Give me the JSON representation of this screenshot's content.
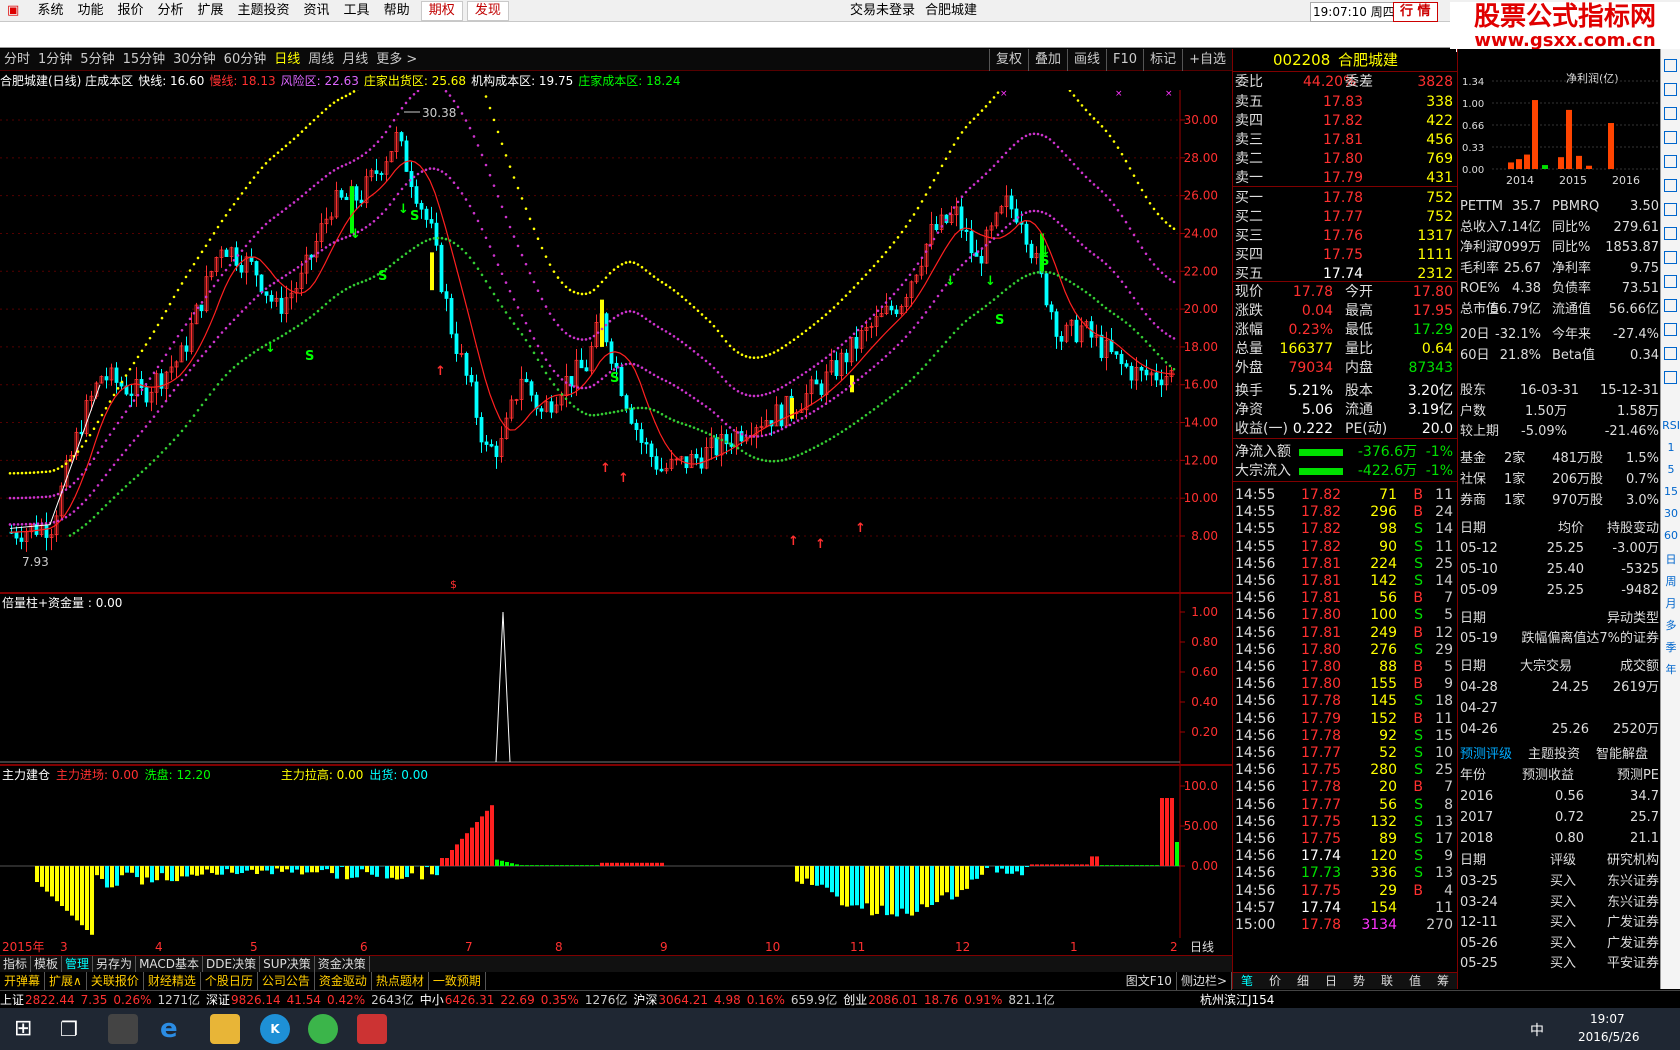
{
  "menu": [
    "系统",
    "功能",
    "报价",
    "分析",
    "扩展",
    "主题投资",
    "资讯",
    "工具",
    "帮助"
  ],
  "menu_hl": [
    "期权",
    "发现"
  ],
  "login": "交易未登录",
  "stock_name_top": "合肥城建",
  "clock": "19:07:10 周四",
  "trade_btn": "行 情",
  "brand": {
    "title": "股票公式指标网",
    "url": "www.gsxx.com.cn"
  },
  "timeframes": [
    "分时",
    "1分钟",
    "5分钟",
    "15分钟",
    "30分钟",
    "60分钟",
    "日线",
    "周线",
    "月线",
    "更多 >"
  ],
  "active_tf": "日线",
  "tf_right": [
    "复权",
    "叠加",
    "画线",
    "F10",
    "标记",
    "+自选"
  ],
  "ind1": [
    {
      "t": "合肥城建(日线) 庄成本区",
      "c": "#ffffff"
    },
    {
      "t": "快线: 16.60",
      "c": "#ffffff"
    },
    {
      "t": "慢线: 18.13",
      "c": "#ff3030"
    },
    {
      "t": "风险区: 22.63",
      "c": "#dd66ff"
    },
    {
      "t": "庄家出货区: 25.68",
      "c": "#ffff00"
    },
    {
      "t": "机构成本区: 19.75",
      "c": "#ffffff"
    },
    {
      "t": "庄家成本区: 18.24",
      "c": "#00ff00"
    }
  ],
  "price_axis": [
    "30.00",
    "28.00",
    "26.00",
    "24.00",
    "22.00",
    "20.00",
    "18.00",
    "16.00",
    "14.00",
    "12.00",
    "10.00",
    "8.00"
  ],
  "peak_label": "30.38",
  "low_label": "7.93",
  "ind2_title": "倍量柱+资金量 : 0.00",
  "ind2_axis": [
    "1.00",
    "0.80",
    "0.60",
    "0.40",
    "0.20"
  ],
  "ind3": [
    {
      "t": "主力建仓",
      "c": "#ffffff"
    },
    {
      "t": "主力进场: 0.00",
      "c": "#ff3030"
    },
    {
      "t": "洗盘: 12.20",
      "c": "#00ff00"
    },
    {
      "t": "主力拉高: 0.00",
      "c": "#ffff00"
    },
    {
      "t": "出货: 0.00",
      "c": "#00ffff"
    }
  ],
  "ind3_axis": [
    "100.0",
    "50.00",
    "0.00"
  ],
  "date_axis": [
    "2015年",
    "3",
    "4",
    "5",
    "6",
    "7",
    "8",
    "9",
    "10",
    "11",
    "12",
    "1",
    "2"
  ],
  "period_label": "日线",
  "quote": {
    "code": "002208",
    "name": "合肥城建",
    "weibi_l": "委比",
    "weibi": "44.20%",
    "weicha_l": "委差",
    "weicha": "3828",
    "asks": [
      {
        "l": "卖五",
        "p": "17.83",
        "v": "338"
      },
      {
        "l": "卖四",
        "p": "17.82",
        "v": "422"
      },
      {
        "l": "卖三",
        "p": "17.81",
        "v": "456"
      },
      {
        "l": "卖二",
        "p": "17.80",
        "v": "769"
      },
      {
        "l": "卖一",
        "p": "17.79",
        "v": "431"
      }
    ],
    "bids": [
      {
        "l": "买一",
        "p": "17.78",
        "v": "752"
      },
      {
        "l": "买二",
        "p": "17.77",
        "v": "752"
      },
      {
        "l": "买三",
        "p": "17.76",
        "v": "1317"
      },
      {
        "l": "买四",
        "p": "17.75",
        "v": "1111"
      },
      {
        "l": "买五",
        "p": "17.74",
        "v": "2312"
      }
    ],
    "stats": [
      {
        "l1": "现价",
        "v1": "17.78",
        "c1": "#ff3030",
        "l2": "今开",
        "v2": "17.80",
        "c2": "#ff3030"
      },
      {
        "l1": "涨跌",
        "v1": "0.04",
        "c1": "#ff3030",
        "l2": "最高",
        "v2": "17.95",
        "c2": "#ff3030"
      },
      {
        "l1": "涨幅",
        "v1": "0.23%",
        "c1": "#ff3030",
        "l2": "最低",
        "v2": "17.29",
        "c2": "#00e000"
      },
      {
        "l1": "总量",
        "v1": "166377",
        "c1": "#ffff00",
        "l2": "量比",
        "v2": "0.64",
        "c2": "#ffff00"
      },
      {
        "l1": "外盘",
        "v1": "79034",
        "c1": "#ff3030",
        "l2": "内盘",
        "v2": "87343",
        "c2": "#00e000"
      },
      {
        "l1": "换手",
        "v1": "5.21%",
        "c1": "#ffffff",
        "l2": "股本",
        "v2": "3.20亿",
        "c2": "#ffffff"
      },
      {
        "l1": "净资",
        "v1": "5.06",
        "c1": "#ffffff",
        "l2": "流通",
        "v2": "3.19亿",
        "c2": "#ffffff"
      },
      {
        "l1": "收益(一)",
        "v1": "0.222",
        "c1": "#ffffff",
        "l2": "PE(动)",
        "v2": "20.0",
        "c2": "#ffffff"
      }
    ],
    "flow": [
      {
        "l": "净流入额",
        "v": "-376.6万",
        "p": "-1%"
      },
      {
        "l": "大宗流入",
        "v": "-422.6万",
        "p": "-1%"
      }
    ],
    "ticks": [
      [
        "14:55",
        "17.82",
        "71",
        "B",
        "11"
      ],
      [
        "14:55",
        "17.82",
        "296",
        "B",
        "24"
      ],
      [
        "14:55",
        "17.82",
        "98",
        "S",
        "14"
      ],
      [
        "14:55",
        "17.82",
        "90",
        "S",
        "11"
      ],
      [
        "14:56",
        "17.81",
        "224",
        "S",
        "25"
      ],
      [
        "14:56",
        "17.81",
        "142",
        "S",
        "14"
      ],
      [
        "14:56",
        "17.81",
        "56",
        "B",
        "7"
      ],
      [
        "14:56",
        "17.80",
        "100",
        "S",
        "5"
      ],
      [
        "14:56",
        "17.81",
        "249",
        "B",
        "12"
      ],
      [
        "14:56",
        "17.80",
        "276",
        "S",
        "29"
      ],
      [
        "14:56",
        "17.80",
        "88",
        "B",
        "5"
      ],
      [
        "14:56",
        "17.80",
        "155",
        "B",
        "9"
      ],
      [
        "14:56",
        "17.78",
        "145",
        "S",
        "18"
      ],
      [
        "14:56",
        "17.79",
        "152",
        "B",
        "11"
      ],
      [
        "14:56",
        "17.78",
        "92",
        "S",
        "15"
      ],
      [
        "14:56",
        "17.77",
        "52",
        "S",
        "10"
      ],
      [
        "14:56",
        "17.75",
        "280",
        "S",
        "25"
      ],
      [
        "14:56",
        "17.78",
        "20",
        "B",
        "7"
      ],
      [
        "14:56",
        "17.77",
        "56",
        "S",
        "8"
      ],
      [
        "14:56",
        "17.75",
        "132",
        "S",
        "13"
      ],
      [
        "14:56",
        "17.75",
        "89",
        "S",
        "17"
      ],
      [
        "14:56",
        "17.74",
        "120",
        "S",
        "9"
      ],
      [
        "14:56",
        "17.73",
        "336",
        "S",
        "13"
      ],
      [
        "14:56",
        "17.75",
        "29",
        "B",
        "4"
      ],
      [
        "14:57",
        "17.74",
        "154",
        "",
        "11"
      ],
      [
        "15:00",
        "17.78",
        "3134",
        "",
        "270"
      ]
    ],
    "bottom_tabs": [
      "笔",
      "价",
      "细",
      "日",
      "势",
      "联",
      "值",
      "筹"
    ]
  },
  "fin": {
    "chart_years": [
      "2014",
      "2015",
      "2016"
    ],
    "chart_axis": [
      "1.34",
      "1.00",
      "0.66",
      "0.33",
      "0.00"
    ],
    "chart_title": "净利润(亿)",
    "chart_data": {
      "type": "bar",
      "categories": [
        "2014",
        "2015",
        "2016"
      ],
      "note": "净利润(亿)",
      "values": [
        0.1,
        0.15,
        0.22,
        1.05,
        0.06,
        0.18,
        0.9,
        0.2,
        0.05,
        0.7
      ]
    },
    "rows1": [
      [
        "PETTM",
        "35.7",
        "PBMRQ",
        "3.50"
      ],
      [
        "总收入",
        "7.14亿",
        "同比%",
        "279.61"
      ],
      [
        "净利润",
        "7099万",
        "同比%",
        "1853.87"
      ],
      [
        "毛利率",
        "25.67",
        "净利率",
        "9.75"
      ],
      [
        "ROE%",
        "4.38",
        "负债率",
        "73.51"
      ],
      [
        "总市值",
        "56.79亿",
        "流通值",
        "56.66亿"
      ],
      [
        "20日",
        "-32.1%",
        "今年来",
        "-27.4%"
      ],
      [
        "60日",
        "21.8%",
        "Beta值",
        "0.34"
      ]
    ],
    "holders_h": [
      "股东",
      "16-03-31",
      "15-12-31"
    ],
    "holders": [
      [
        "户数",
        "1.50万",
        "1.58万"
      ],
      [
        "较上期",
        "-5.09%",
        "-21.46%"
      ]
    ],
    "inst": [
      [
        "基金",
        "2家",
        "481万股",
        "1.5%"
      ],
      [
        "社保",
        "1家",
        "206万股",
        "0.7%"
      ],
      [
        "券商",
        "1家",
        "970万股",
        "3.0%"
      ]
    ],
    "trade_h": [
      "日期",
      "均价",
      "持股变动"
    ],
    "trades": [
      [
        "05-12",
        "25.25",
        "-3.00万"
      ],
      [
        "05-10",
        "25.40",
        "-5325"
      ],
      [
        "05-09",
        "25.25",
        "-9482"
      ]
    ],
    "abn_h": [
      "日期",
      "异动类型"
    ],
    "abn": [
      [
        "05-19",
        "跌幅偏离值达7%的证券"
      ]
    ],
    "block_h": [
      "日期",
      "大宗交易",
      "成交额"
    ],
    "blocks": [
      [
        "04-28",
        "24.25",
        "2619万"
      ],
      [
        "04-27",
        "",
        ""
      ],
      [
        "04-26",
        "25.26",
        "2520万"
      ]
    ],
    "fc_tabs": [
      "预测评级",
      "主题投资",
      "智能解盘"
    ],
    "fc_h": [
      "年份",
      "预测收益",
      "预测PE"
    ],
    "fc": [
      [
        "2016",
        "0.56",
        "34.7"
      ],
      [
        "2017",
        "0.72",
        "25.7"
      ],
      [
        "2018",
        "0.80",
        "21.1"
      ]
    ],
    "rate_h": [
      "日期",
      "评级",
      "研究机构"
    ],
    "rates": [
      [
        "03-25",
        "买入",
        "东兴证券"
      ],
      [
        "03-24",
        "买入",
        "东兴证券"
      ],
      [
        "12-11",
        "买入",
        "广发证券"
      ],
      [
        "05-26",
        "买入",
        "广发证券"
      ],
      [
        "05-25",
        "买入",
        "平安证券"
      ]
    ]
  },
  "tabs1": [
    "指标",
    "模板",
    "管理",
    "另存为",
    "MACD基本",
    "DDE决策",
    "SUP决策",
    "资金决策"
  ],
  "tabs1_on": "管理",
  "tabs2": [
    "开弹幕",
    "扩展∧",
    "关联报价",
    "财经精选",
    "个股日历",
    "公司公告",
    "资金驱动",
    "热点题材",
    "一致预期"
  ],
  "tabs2_right": [
    "图文F10",
    "侧边栏>"
  ],
  "status": [
    {
      "n": "上证",
      "v": "2822.44",
      "d": "7.35",
      "p": "0.26%",
      "a": "1271亿"
    },
    {
      "n": "深证",
      "v": "9826.14",
      "d": "41.54",
      "p": "0.42%",
      "a": "2643亿"
    },
    {
      "n": "中小",
      "v": "6426.31",
      "d": "22.69",
      "p": "0.35%",
      "a": "1276亿"
    },
    {
      "n": "沪深",
      "v": "3064.21",
      "d": "4.98",
      "p": "0.16%",
      "a": "659.9亿"
    },
    {
      "n": "创业",
      "v": "2086.01",
      "d": "18.76",
      "p": "0.91%",
      "a": "821.1亿"
    }
  ],
  "status_right": "杭州滨江J154",
  "tray": {
    "time": "19:07",
    "date": "2016/5/26",
    "ime": "中"
  },
  "sidebar": [
    "RSI",
    "1",
    "5",
    "15",
    "30",
    "60",
    "日",
    "周",
    "月",
    "多",
    "季",
    "年"
  ],
  "ime_bar": "中"
}
